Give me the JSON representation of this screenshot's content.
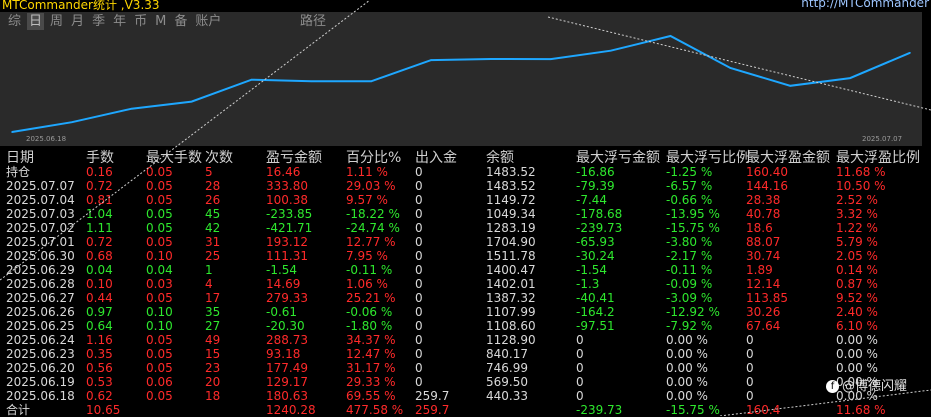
{
  "app": {
    "title": "MTCommander统计  ,V3.33",
    "url": "http://MTCommander"
  },
  "tabs": [
    {
      "label": "综",
      "active": false
    },
    {
      "label": "日",
      "active": true
    },
    {
      "label": "周",
      "active": false
    },
    {
      "label": "月",
      "active": false
    },
    {
      "label": "季",
      "active": false
    },
    {
      "label": "年",
      "active": false
    },
    {
      "label": "币",
      "active": false
    },
    {
      "label": "M",
      "active": false
    },
    {
      "label": "备",
      "active": false
    },
    {
      "label": "账户",
      "active": false
    }
  ],
  "tab_path": "路径",
  "chart_data": {
    "type": "line",
    "x_start_label": "2025.06.18",
    "x_end_label": "2025.07.07",
    "x": [
      "2025.06.18",
      "2025.06.19",
      "2025.06.20",
      "2025.06.23",
      "2025.06.24",
      "2025.06.25",
      "2025.06.26",
      "2025.06.27",
      "2025.06.28",
      "2025.06.29",
      "2025.06.30",
      "2025.07.01",
      "2025.07.02",
      "2025.07.03",
      "2025.07.04",
      "2025.07.07"
    ],
    "values": [
      440.33,
      569.5,
      746.99,
      840.17,
      1128.9,
      1108.6,
      1107.99,
      1387.32,
      1402.01,
      1400.47,
      1511.78,
      1704.9,
      1283.19,
      1049.34,
      1149.72,
      1483.52
    ],
    "line_color": "#1ea7ff"
  },
  "table": {
    "headers": [
      "日期",
      "手数",
      "最大手数",
      "次数",
      "盈亏金额",
      "百分比%",
      "出入金",
      "余额",
      "最大浮亏金额",
      "最大浮亏比例",
      "最大浮盈金额",
      "最大浮盈比例"
    ],
    "holding": {
      "date": "持仓",
      "lots": "0.16",
      "max_lots": "0.05",
      "count": "5",
      "pnl": "16.46",
      "pct": "1.11 %",
      "io": "0",
      "balance": "1483.52",
      "max_float_loss": "-16.86",
      "max_float_loss_pct": "-1.25 %",
      "max_float_profit": "160.40",
      "max_float_profit_pct": "11.68 %"
    },
    "rows": [
      {
        "date": "2025.07.07",
        "lots": "0.72",
        "max_lots": "0.05",
        "count": "28",
        "pnl": "333.80",
        "pct": "29.03 %",
        "io": "0",
        "balance": "1483.52",
        "max_float_loss": "-79.39",
        "max_float_loss_pct": "-6.57 %",
        "max_float_profit": "144.16",
        "max_float_profit_pct": "10.50 %",
        "pos": true
      },
      {
        "date": "2025.07.04",
        "lots": "0.81",
        "max_lots": "0.05",
        "count": "26",
        "pnl": "100.38",
        "pct": "9.57 %",
        "io": "0",
        "balance": "1149.72",
        "max_float_loss": "-7.44",
        "max_float_loss_pct": "-0.66 %",
        "max_float_profit": "28.38",
        "max_float_profit_pct": "2.52 %",
        "pos": true
      },
      {
        "date": "2025.07.03",
        "lots": "1.04",
        "max_lots": "0.05",
        "count": "45",
        "pnl": "-233.85",
        "pct": "-18.22 %",
        "io": "0",
        "balance": "1049.34",
        "max_float_loss": "-178.68",
        "max_float_loss_pct": "-13.95 %",
        "max_float_profit": "40.78",
        "max_float_profit_pct": "3.32 %",
        "pos": false
      },
      {
        "date": "2025.07.02",
        "lots": "1.11",
        "max_lots": "0.05",
        "count": "42",
        "pnl": "-421.71",
        "pct": "-24.74 %",
        "io": "0",
        "balance": "1283.19",
        "max_float_loss": "-239.73",
        "max_float_loss_pct": "-15.75 %",
        "max_float_profit": "18.6",
        "max_float_profit_pct": "1.22 %",
        "pos": false
      },
      {
        "date": "2025.07.01",
        "lots": "0.72",
        "max_lots": "0.05",
        "count": "31",
        "pnl": "193.12",
        "pct": "12.77 %",
        "io": "0",
        "balance": "1704.90",
        "max_float_loss": "-65.93",
        "max_float_loss_pct": "-3.80 %",
        "max_float_profit": "88.07",
        "max_float_profit_pct": "5.79 %",
        "pos": true
      },
      {
        "date": "2025.06.30",
        "lots": "0.68",
        "max_lots": "0.10",
        "count": "25",
        "pnl": "111.31",
        "pct": "7.95 %",
        "io": "0",
        "balance": "1511.78",
        "max_float_loss": "-30.24",
        "max_float_loss_pct": "-2.17 %",
        "max_float_profit": "30.74",
        "max_float_profit_pct": "2.05 %",
        "pos": true
      },
      {
        "date": "2025.06.29",
        "lots": "0.04",
        "max_lots": "0.04",
        "count": "1",
        "pnl": "-1.54",
        "pct": "-0.11 %",
        "io": "0",
        "balance": "1400.47",
        "max_float_loss": "-1.54",
        "max_float_loss_pct": "-0.11 %",
        "max_float_profit": "1.89",
        "max_float_profit_pct": "0.14 %",
        "pos": false
      },
      {
        "date": "2025.06.28",
        "lots": "0.10",
        "max_lots": "0.03",
        "count": "4",
        "pnl": "14.69",
        "pct": "1.06 %",
        "io": "0",
        "balance": "1402.01",
        "max_float_loss": "-1.3",
        "max_float_loss_pct": "-0.09 %",
        "max_float_profit": "12.14",
        "max_float_profit_pct": "0.87 %",
        "pos": true
      },
      {
        "date": "2025.06.27",
        "lots": "0.44",
        "max_lots": "0.05",
        "count": "17",
        "pnl": "279.33",
        "pct": "25.21 %",
        "io": "0",
        "balance": "1387.32",
        "max_float_loss": "-40.41",
        "max_float_loss_pct": "-3.09 %",
        "max_float_profit": "113.85",
        "max_float_profit_pct": "9.52 %",
        "pos": true
      },
      {
        "date": "2025.06.26",
        "lots": "0.97",
        "max_lots": "0.10",
        "count": "35",
        "pnl": "-0.61",
        "pct": "-0.06 %",
        "io": "0",
        "balance": "1107.99",
        "max_float_loss": "-164.2",
        "max_float_loss_pct": "-12.92 %",
        "max_float_profit": "30.26",
        "max_float_profit_pct": "2.40 %",
        "pos": false
      },
      {
        "date": "2025.06.25",
        "lots": "0.64",
        "max_lots": "0.10",
        "count": "27",
        "pnl": "-20.30",
        "pct": "-1.80 %",
        "io": "0",
        "balance": "1108.60",
        "max_float_loss": "-97.51",
        "max_float_loss_pct": "-7.92 %",
        "max_float_profit": "67.64",
        "max_float_profit_pct": "6.10 %",
        "pos": false
      },
      {
        "date": "2025.06.24",
        "lots": "1.16",
        "max_lots": "0.05",
        "count": "49",
        "pnl": "288.73",
        "pct": "34.37 %",
        "io": "0",
        "balance": "1128.90",
        "max_float_loss": "0",
        "max_float_loss_pct": "0.00 %",
        "max_float_profit": "0",
        "max_float_profit_pct": "0.00 %",
        "pos": true
      },
      {
        "date": "2025.06.23",
        "lots": "0.35",
        "max_lots": "0.05",
        "count": "15",
        "pnl": "93.18",
        "pct": "12.47 %",
        "io": "0",
        "balance": "840.17",
        "max_float_loss": "0",
        "max_float_loss_pct": "0.00 %",
        "max_float_profit": "0",
        "max_float_profit_pct": "0.00 %",
        "pos": true
      },
      {
        "date": "2025.06.20",
        "lots": "0.56",
        "max_lots": "0.05",
        "count": "23",
        "pnl": "177.49",
        "pct": "31.17 %",
        "io": "0",
        "balance": "746.99",
        "max_float_loss": "0",
        "max_float_loss_pct": "0.00 %",
        "max_float_profit": "0",
        "max_float_profit_pct": "0.00 %",
        "pos": true
      },
      {
        "date": "2025.06.19",
        "lots": "0.53",
        "max_lots": "0.06",
        "count": "20",
        "pnl": "129.17",
        "pct": "29.33 %",
        "io": "0",
        "balance": "569.50",
        "max_float_loss": "0",
        "max_float_loss_pct": "0.00 %",
        "max_float_profit": "0",
        "max_float_profit_pct": "0.00 %",
        "pos": true
      },
      {
        "date": "2025.06.18",
        "lots": "0.62",
        "max_lots": "0.05",
        "count": "18",
        "pnl": "180.63",
        "pct": "69.55 %",
        "io": "259.7",
        "balance": "440.33",
        "max_float_loss": "0",
        "max_float_loss_pct": "0.00 %",
        "max_float_profit": "0",
        "max_float_profit_pct": "0.00 %",
        "pos": true
      }
    ],
    "total": {
      "date": "合计",
      "lots": "10.65",
      "max_lots": "",
      "count": "",
      "pnl": "1240.28",
      "pct": "477.58 %",
      "io": "259.7",
      "balance": "",
      "max_float_loss": "-239.73",
      "max_float_loss_pct": "-15.75 %",
      "max_float_profit": "160.4",
      "max_float_profit_pct": "11.68 %"
    }
  },
  "watermark": "@博德闪耀",
  "colors": {
    "positive": "#ff2a2a",
    "negative": "#2ee82e",
    "line": "#1ea7ff"
  }
}
